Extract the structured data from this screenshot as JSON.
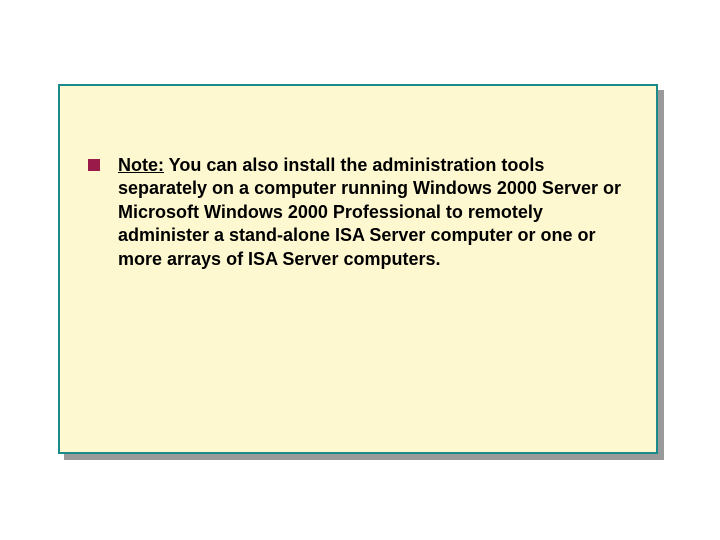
{
  "slide": {
    "bullet": {
      "label": "Note:",
      "body": " You can also install the administration tools separately on a computer running Windows 2000 Server or Microsoft Windows 2000 Professional to remotely administer a stand-alone ISA Server computer or one or more arrays of ISA Server computers."
    }
  }
}
